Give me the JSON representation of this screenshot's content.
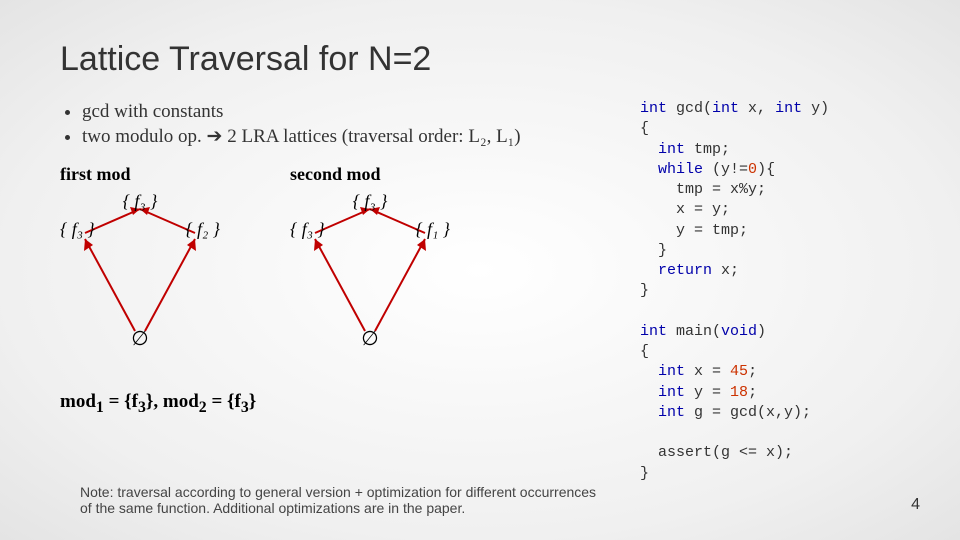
{
  "title": "Lattice Traversal for N=2",
  "bullets": [
    "gcd with constants",
    "two modulo op. ➔ 2 LRA lattices (traversal order: L₂, L₁)"
  ],
  "lattice1": {
    "label": "first mod",
    "top": "{ f₃ }",
    "left": "{ f₃ }",
    "right": "{ f₂ }",
    "bottom": "∅"
  },
  "lattice2": {
    "label": "second mod",
    "top": "{ f₃ }",
    "left": "{ f₃ }",
    "right": "{ f₁ }",
    "bottom": "∅"
  },
  "modline_html": "mod<sub>1</sub> = {f<sub>3</sub>}, mod<sub>2</sub> = {f<sub>3</sub>}",
  "note": "Note: traversal according to general version + optimization for different occurrences of the same function. Additional optimizations are in the paper.",
  "pagenum": "4",
  "code": {
    "l1": "int gcd(int x, int y)",
    "l2": "{",
    "l3": "  int tmp;",
    "l4": "  while (y!=0){",
    "l5": "    tmp = x%y;",
    "l6": "    x = y;",
    "l7": "    y = tmp;",
    "l8": "  }",
    "l9": "  return x;",
    "l10": "}",
    "l11": "",
    "l12": "int main(void)",
    "l13": "{",
    "l14": "  int x = 45;",
    "l15": "  int y = 18;",
    "l16": "  int g = gcd(x,y);",
    "l17": "",
    "l18": "  assert(g <= x);",
    "l19": "}"
  }
}
